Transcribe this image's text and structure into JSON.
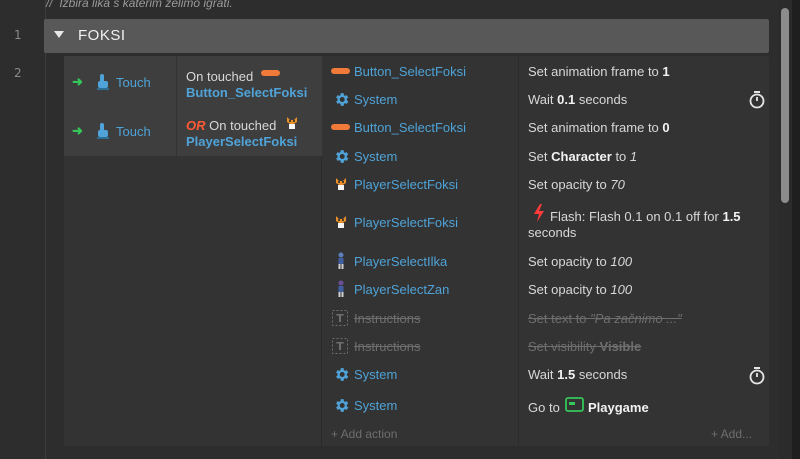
{
  "comment": "Izbira lika s katerim želimo igrati.",
  "line_numbers": [
    "1",
    "2"
  ],
  "group": {
    "title": "FOKSI"
  },
  "conditions": [
    {
      "trigger": "Touch",
      "prefix": "On touched",
      "object": "Button_SelectFoksi",
      "icon": "button-pill-icon"
    },
    {
      "trigger": "Touch",
      "or_label": "OR",
      "prefix": "On touched",
      "object": "PlayerSelectFoksi",
      "icon": "fox-sprite-icon"
    }
  ],
  "actions": [
    {
      "object": "Button_SelectFoksi",
      "icon": "button-pill-icon",
      "text": "Set animation frame to ",
      "value": "1"
    },
    {
      "object": "System",
      "icon": "gear-icon",
      "text": "Wait ",
      "value": "0.1",
      "suffix": " seconds",
      "timer": true
    },
    {
      "object": "Button_SelectFoksi",
      "icon": "button-pill-icon",
      "text": "Set animation frame to ",
      "value": "0"
    },
    {
      "object": "System",
      "icon": "gear-icon",
      "text": "Set ",
      "value": "Character",
      "mid": " to ",
      "value2": "1"
    },
    {
      "object": "PlayerSelectFoksi",
      "icon": "fox-sprite-icon",
      "text": "Set opacity to ",
      "value": "70"
    },
    {
      "object": "PlayerSelectFoksi",
      "icon": "fox-sprite-icon",
      "text": "Flash: Flash 0.1 on 0.1 off for ",
      "value": "1.5",
      "suffix": "seconds",
      "flash": true
    },
    {
      "object": "PlayerSelectIlka",
      "icon": "character-sprite-icon",
      "text": "Set opacity to ",
      "value": "100"
    },
    {
      "object": "PlayerSelectZan",
      "icon": "character-sprite-icon",
      "text": "Set opacity to ",
      "value": "100"
    },
    {
      "object": "Instructions",
      "icon": "text-object-icon",
      "text": "Set text to ",
      "value": "\"Pa začnimo ...\"",
      "disabled": true
    },
    {
      "object": "Instructions",
      "icon": "text-object-icon",
      "text": "Set visibility ",
      "value": "Visible",
      "disabled": true
    },
    {
      "object": "System",
      "icon": "gear-icon",
      "text": "Wait ",
      "value": "1.5",
      "suffix": " seconds",
      "timer": true
    },
    {
      "object": "System",
      "icon": "gear-icon",
      "text": "Go to ",
      "value": "Playgame",
      "layout_icon": "layout-icon"
    }
  ],
  "add_action_label": "+ Add action",
  "add_label": "+ Add...",
  "colors": {
    "object_blue": "#4fa3d8",
    "or_red": "#ff5a36",
    "pill_orange": "#f07a3a",
    "touch_green": "#34c759",
    "layout_green": "#34c759"
  }
}
